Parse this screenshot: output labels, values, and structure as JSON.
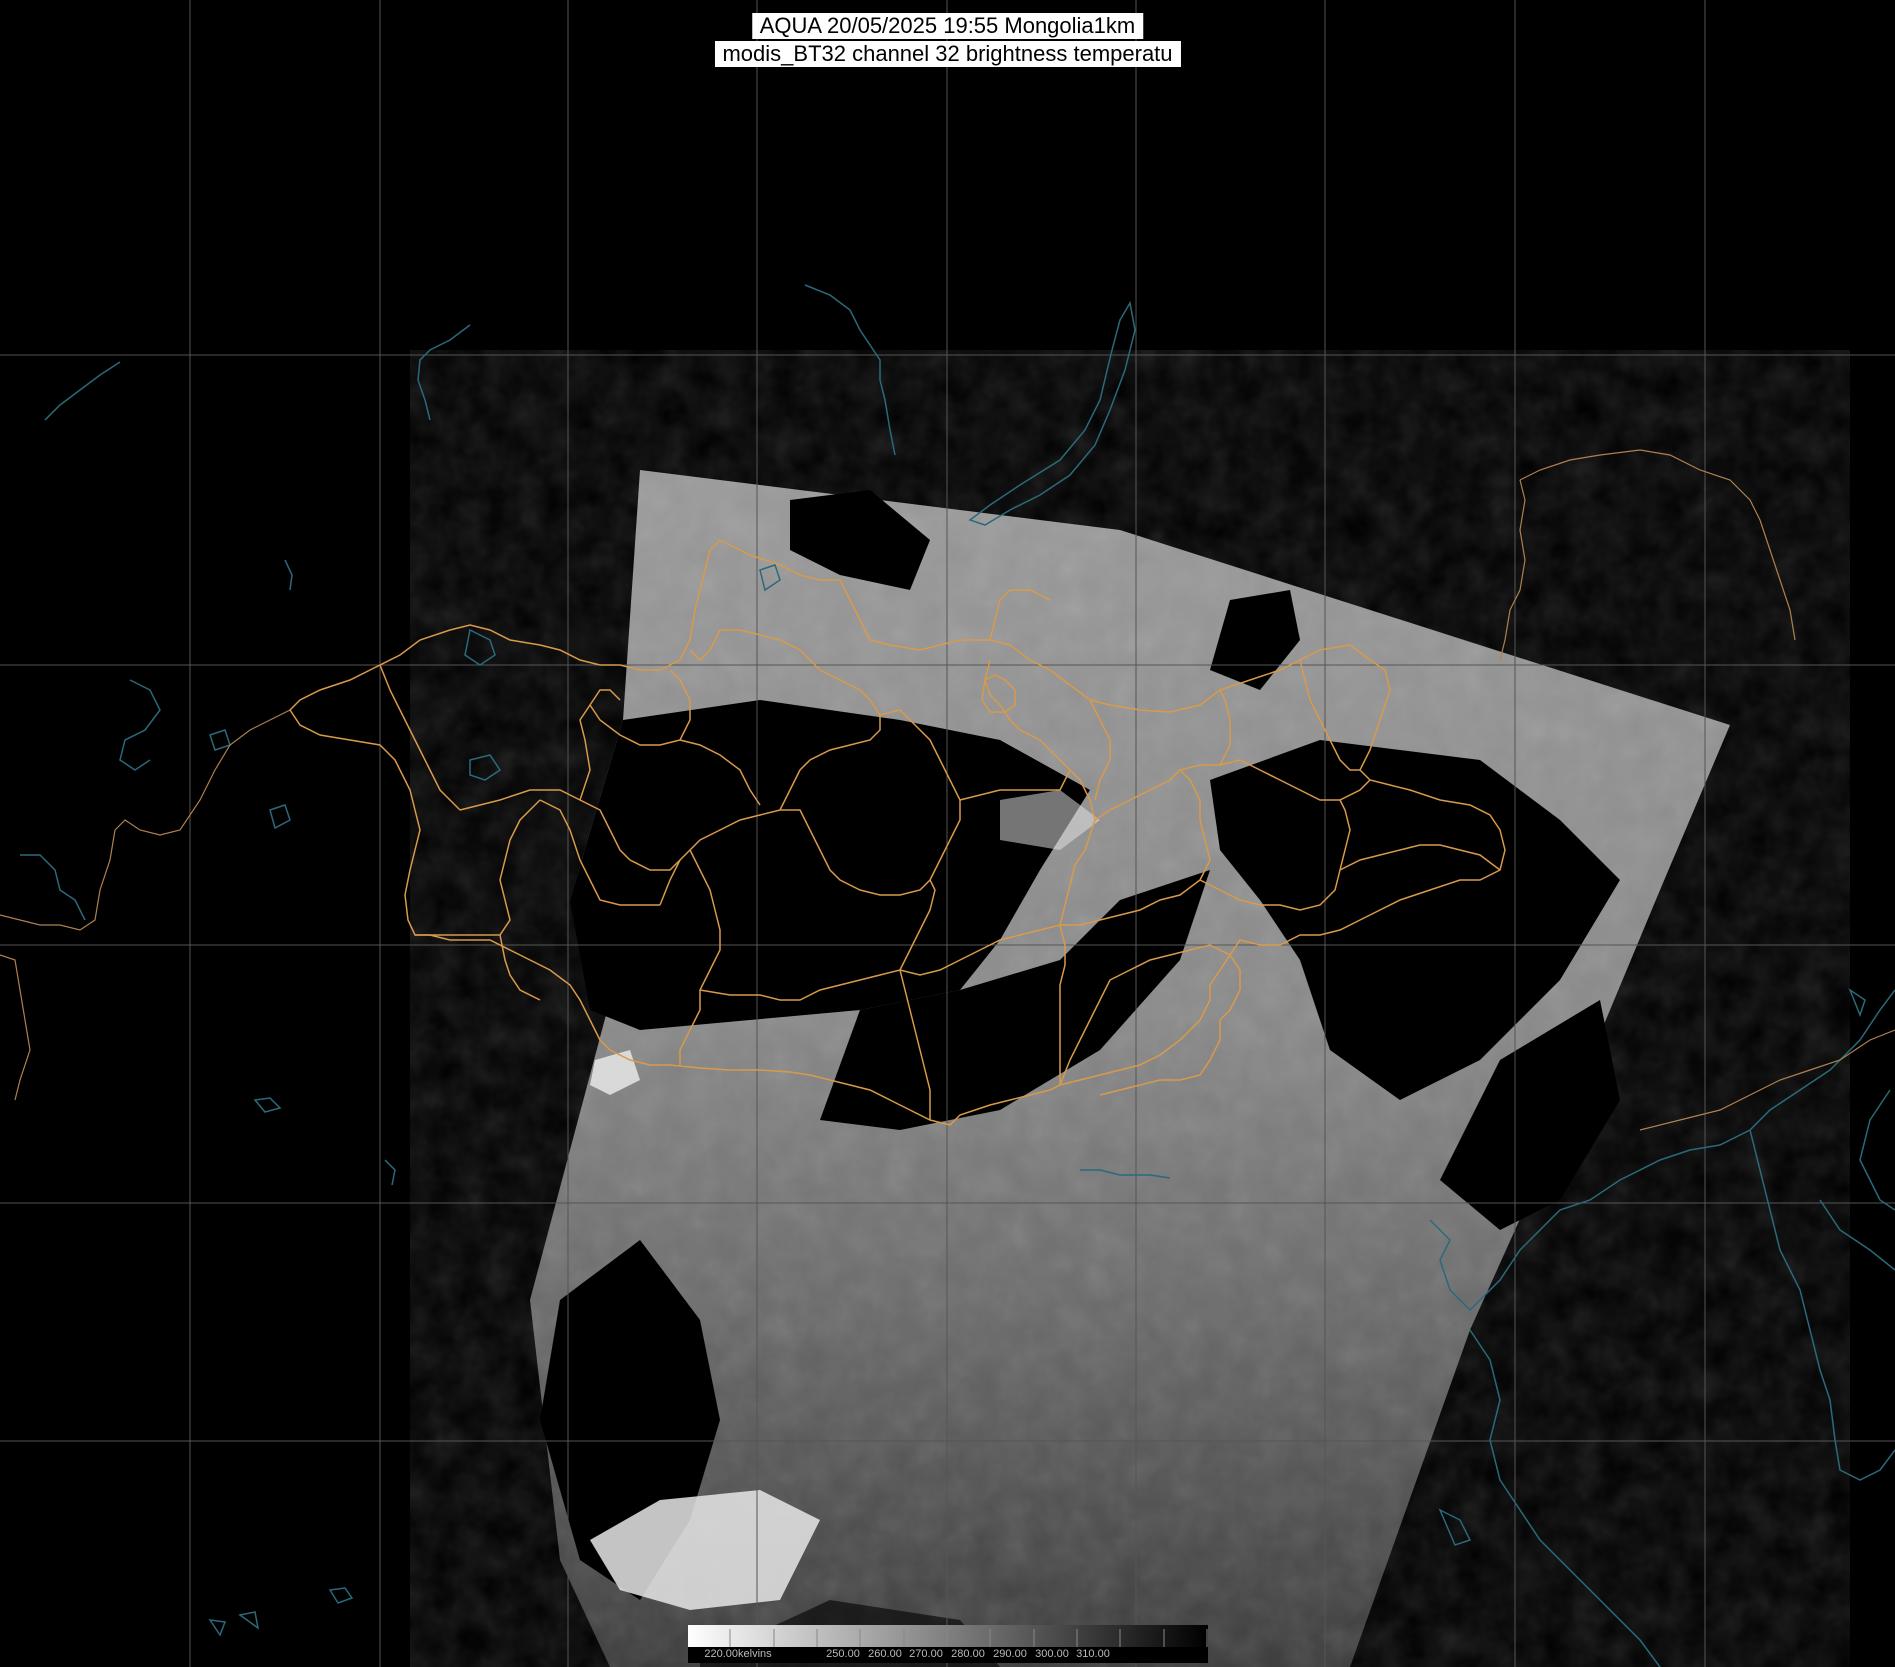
{
  "title": {
    "line1": "AQUA 20/05/2025 19:55 Mongolia1km",
    "line2": "modis_BT32 channel 32 brightness temperatu"
  },
  "colorbar": {
    "unit_label": "220.00kelvins",
    "tick_labels": [
      "250.00",
      "260.00",
      "270.00",
      "280.00",
      "290.00",
      "300.00",
      "310.00"
    ],
    "range": [
      220,
      320
    ],
    "direction": "white-to-black"
  },
  "colors": {
    "background": "#000000",
    "grid": "#555555",
    "admin_borders": "#d99a4a",
    "coast_lakes": "#2a6a7a",
    "outer_border": "#b08050"
  }
}
